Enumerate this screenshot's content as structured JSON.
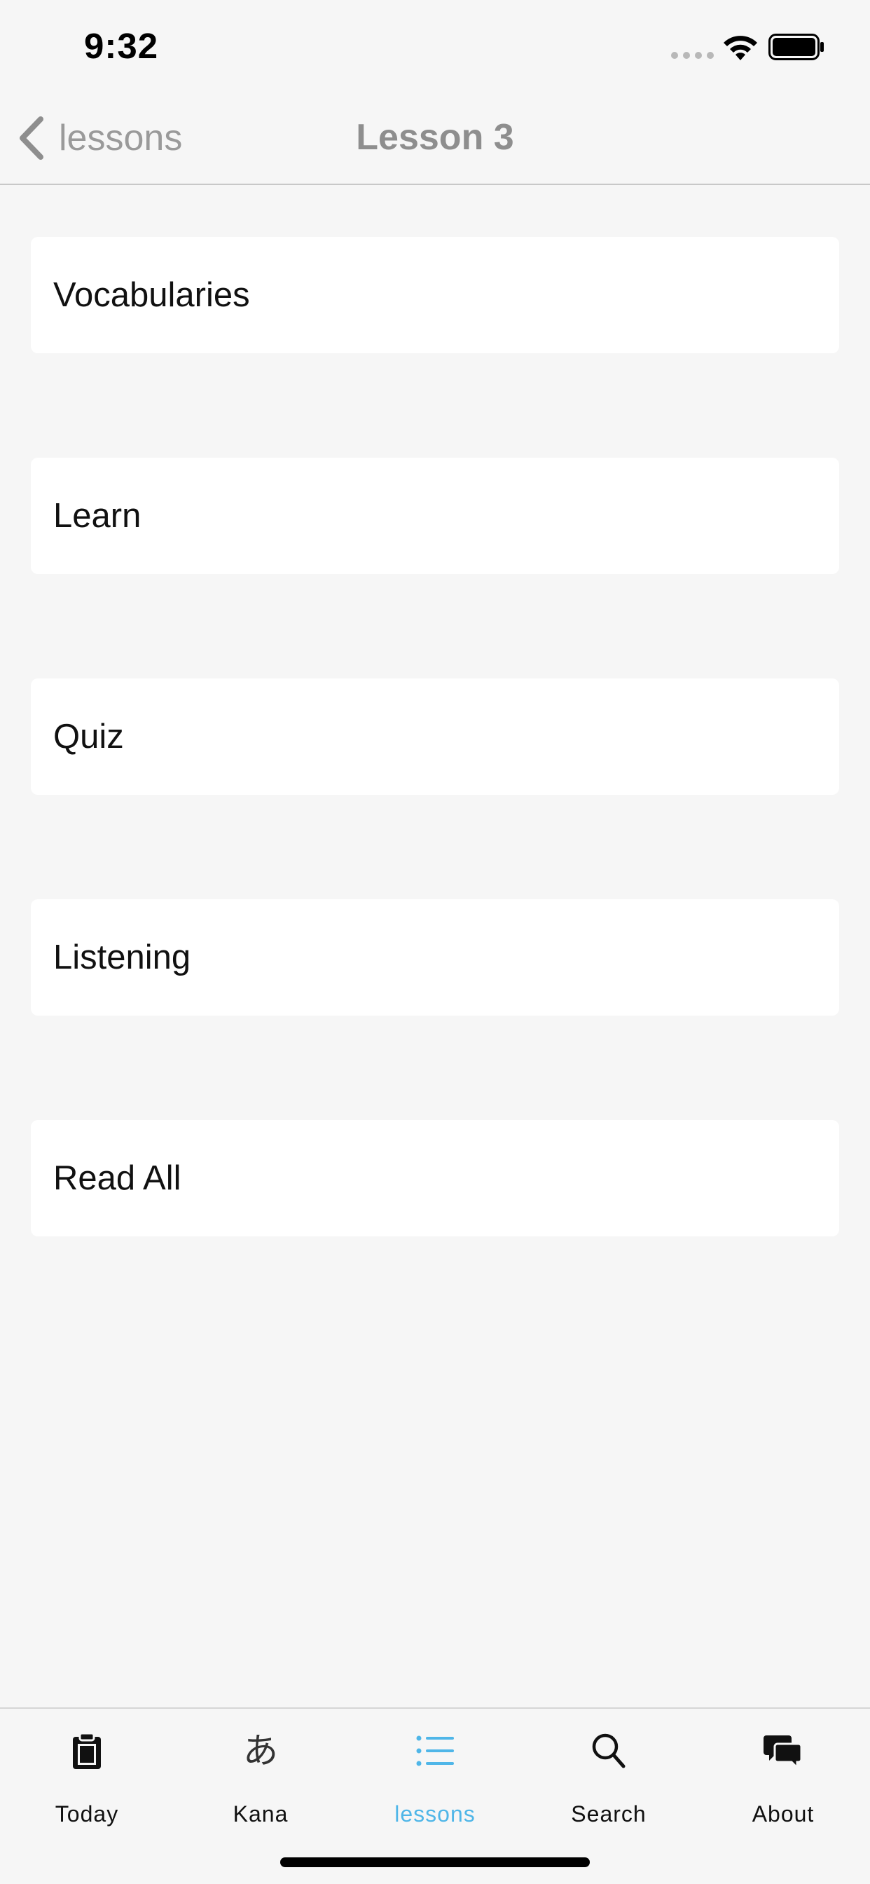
{
  "status_bar": {
    "time": "9:32"
  },
  "nav_bar": {
    "back_label": "lessons",
    "title": "Lesson 3"
  },
  "menu": {
    "items": [
      {
        "label": "Vocabularies"
      },
      {
        "label": "Learn"
      },
      {
        "label": "Quiz"
      },
      {
        "label": "Listening"
      },
      {
        "label": "Read All"
      }
    ]
  },
  "tab_bar": {
    "active": "lessons",
    "active_color": "#4fb6e8",
    "tabs": [
      {
        "label": "Today",
        "icon": "clipboard-icon"
      },
      {
        "label": "Kana",
        "icon": "kana-icon",
        "glyph": "あ"
      },
      {
        "label": "lessons",
        "icon": "list-icon"
      },
      {
        "label": "Search",
        "icon": "search-icon"
      },
      {
        "label": "About",
        "icon": "chat-bubbles-icon"
      }
    ]
  }
}
